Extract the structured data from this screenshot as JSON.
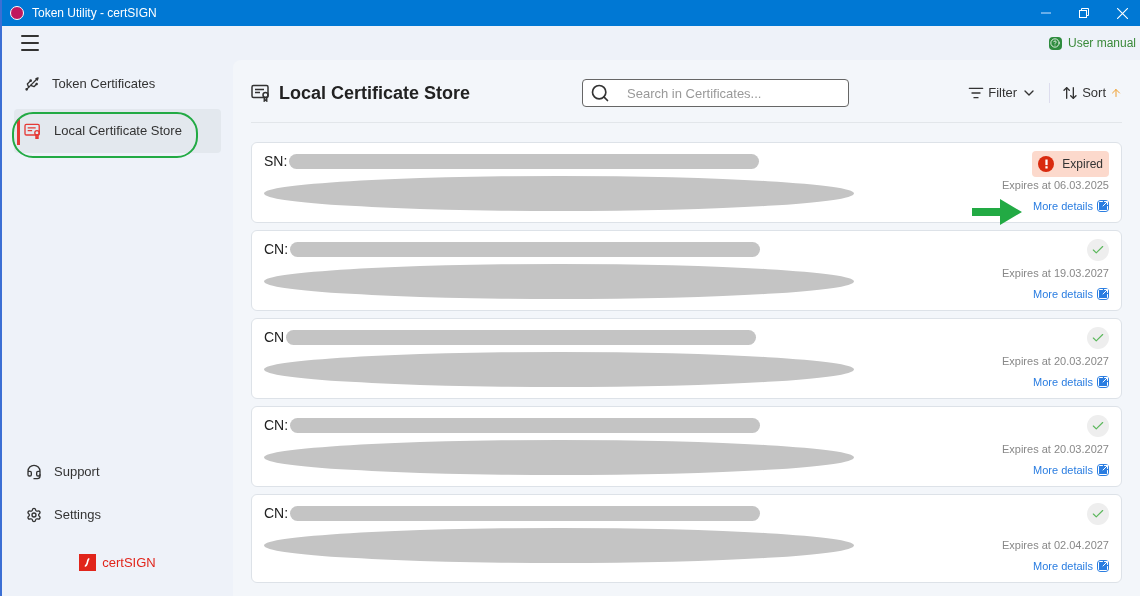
{
  "window": {
    "title": "Token Utility - certSIGN"
  },
  "toolbar": {
    "help_link": "User manual"
  },
  "sidebar": {
    "items": [
      {
        "label": "Token Certificates",
        "kind": "token",
        "selected": false
      },
      {
        "label": "Local Certificate Store",
        "kind": "store",
        "selected": true
      }
    ],
    "bottom_items": [
      {
        "label": "Support",
        "kind": "support"
      },
      {
        "label": "Settings",
        "kind": "settings"
      }
    ],
    "logo": "certSIGN"
  },
  "main": {
    "title": "Local Certificate Store",
    "search": {
      "placeholder": "Search in Certificates..."
    },
    "filter": "Filter",
    "sort": "Sort"
  },
  "certificates": [
    {
      "prefix": "SN:",
      "kind": "expired",
      "badge": "Expired",
      "expires": "Expires at 06.03.2025",
      "link": "More details"
    },
    {
      "prefix": "CN:",
      "kind": "valid",
      "expires": "Expires at 19.03.2027",
      "link": "More details"
    },
    {
      "prefix": "CN",
      "kind": "valid",
      "expires": "Expires at 20.03.2027",
      "link": "More details"
    },
    {
      "prefix": "CN:",
      "kind": "valid",
      "expires": "Expires at 20.03.2027",
      "link": "More details"
    },
    {
      "prefix": "CN:",
      "kind": "valid",
      "expires": "Expires at 02.04.2027",
      "link": "More details"
    }
  ]
}
